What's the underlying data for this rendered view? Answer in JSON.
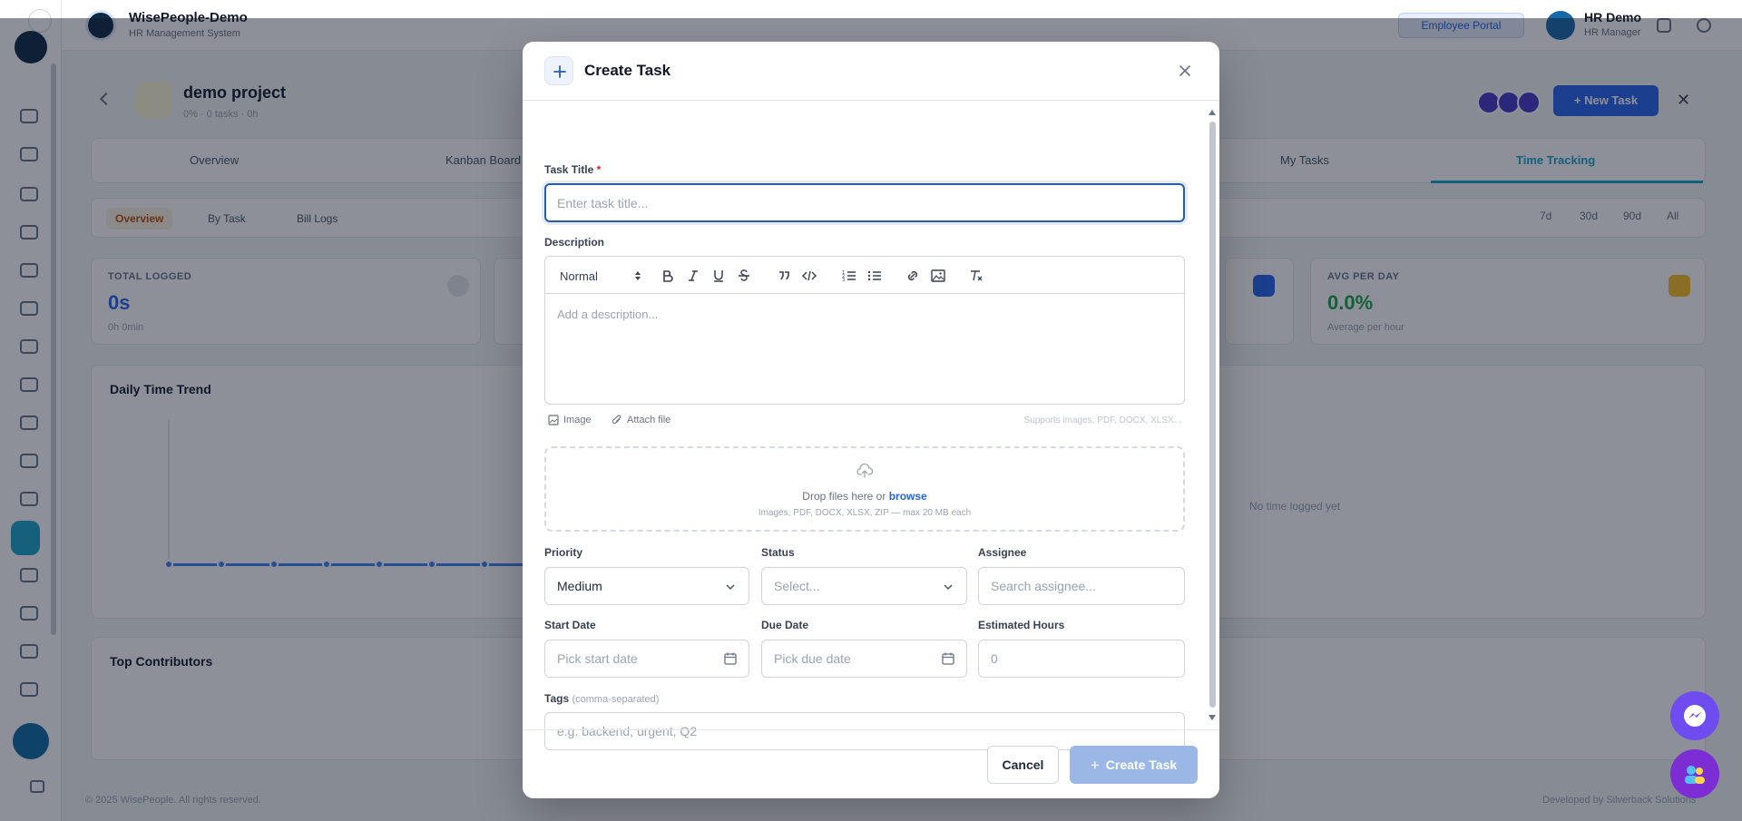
{
  "app": {
    "name": "WisePeople-Demo",
    "subtitle": "HR Management System",
    "employee_portal": "Employee Portal",
    "user_name": "HR Demo",
    "user_role": "HR Manager"
  },
  "project": {
    "name": "demo project",
    "meta": "0% · 0 tasks · 0h",
    "new_task": "+ New Task"
  },
  "tabs": [
    "Overview",
    "Kanban Board",
    "My Tasks",
    "Time Tracking"
  ],
  "subtabs": [
    "Overview",
    "By Task",
    "Bill Logs"
  ],
  "ranges": [
    "7d",
    "30d",
    "90d",
    "All"
  ],
  "stats": [
    {
      "label": "TOTAL LOGGED",
      "value": "0s",
      "sub": "0h 0min"
    },
    {
      "label": "AVG PER DAY",
      "value": "0.0%",
      "sub": "Average per hour"
    }
  ],
  "panels": {
    "daily_trend": "Daily Time Trend",
    "top_contributors": "Top Contributors",
    "no_data": "No time logged yet"
  },
  "footer": {
    "left": "© 2025 WisePeople. All rights reserved.",
    "right": "Developed by Silverback Solutions"
  },
  "modal": {
    "title": "Create Task",
    "task_title_label": "Task Title",
    "required_mark": "*",
    "task_title_placeholder": "Enter task title...",
    "description_label": "Description",
    "editor_style": "Normal",
    "description_placeholder": "Add a description...",
    "image_label": "Image",
    "attach_label": "Attach file",
    "supports_text": "Supports images, PDF, DOCX, XLSX...",
    "drop_text": "Drop files here or",
    "browse_text": "browse",
    "drop_sub": "Images, PDF, DOCX, XLSX, ZIP — max 20 MB each",
    "priority_label": "Priority",
    "priority_value": "Medium",
    "status_label": "Status",
    "status_placeholder": "Select...",
    "assignee_label": "Assignee",
    "assignee_placeholder": "Search assignee...",
    "start_date_label": "Start Date",
    "start_date_placeholder": "Pick start date",
    "due_date_label": "Due Date",
    "due_date_placeholder": "Pick due date",
    "est_hours_label": "Estimated Hours",
    "est_hours_placeholder": "0",
    "tags_label": "Tags",
    "tags_hint": "(comma-separated)",
    "tags_placeholder": "e.g. backend, urgent, Q2",
    "cancel": "Cancel",
    "create": "Create Task"
  },
  "colors": {
    "accent": "#2563eb",
    "focus_border": "#2b5cab",
    "create_disabled": "#9ab7e6",
    "active_tab": "#1aa3c9"
  }
}
